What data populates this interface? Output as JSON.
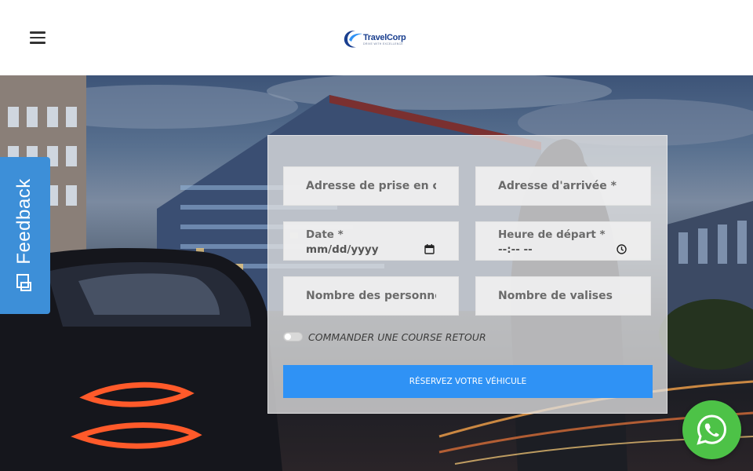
{
  "header": {
    "menu_icon": "hamburger-menu-icon",
    "logo": {
      "name": "TravelCorp",
      "tagline": "DRIVE WITH EXCELLENCE"
    }
  },
  "feedback": {
    "label": "Feedback",
    "icon": "feedback-icon",
    "color": "#3d8fd8"
  },
  "form": {
    "pickup": {
      "placeholder": "Adresse de prise en charge *"
    },
    "arrival": {
      "placeholder": "Adresse d'arrivée *"
    },
    "date": {
      "label": "Date *",
      "value": "mm/dd/yyyy",
      "icon": "calendar-icon"
    },
    "time": {
      "label": "Heure de départ *",
      "value": "--:-- --",
      "icon": "clock-icon"
    },
    "persons": {
      "placeholder": "Nombre des personnes *"
    },
    "luggage": {
      "placeholder": "Nombre de valises"
    },
    "return_toggle": {
      "label": "COMMANDER UNE COURSE RETOUR",
      "checked": false
    },
    "submit_label": "RÉSERVEZ VOTRE VÉHICULE",
    "accent_color": "#2f92f5"
  },
  "whatsapp": {
    "icon": "whatsapp-icon",
    "color": "#4dc247"
  }
}
